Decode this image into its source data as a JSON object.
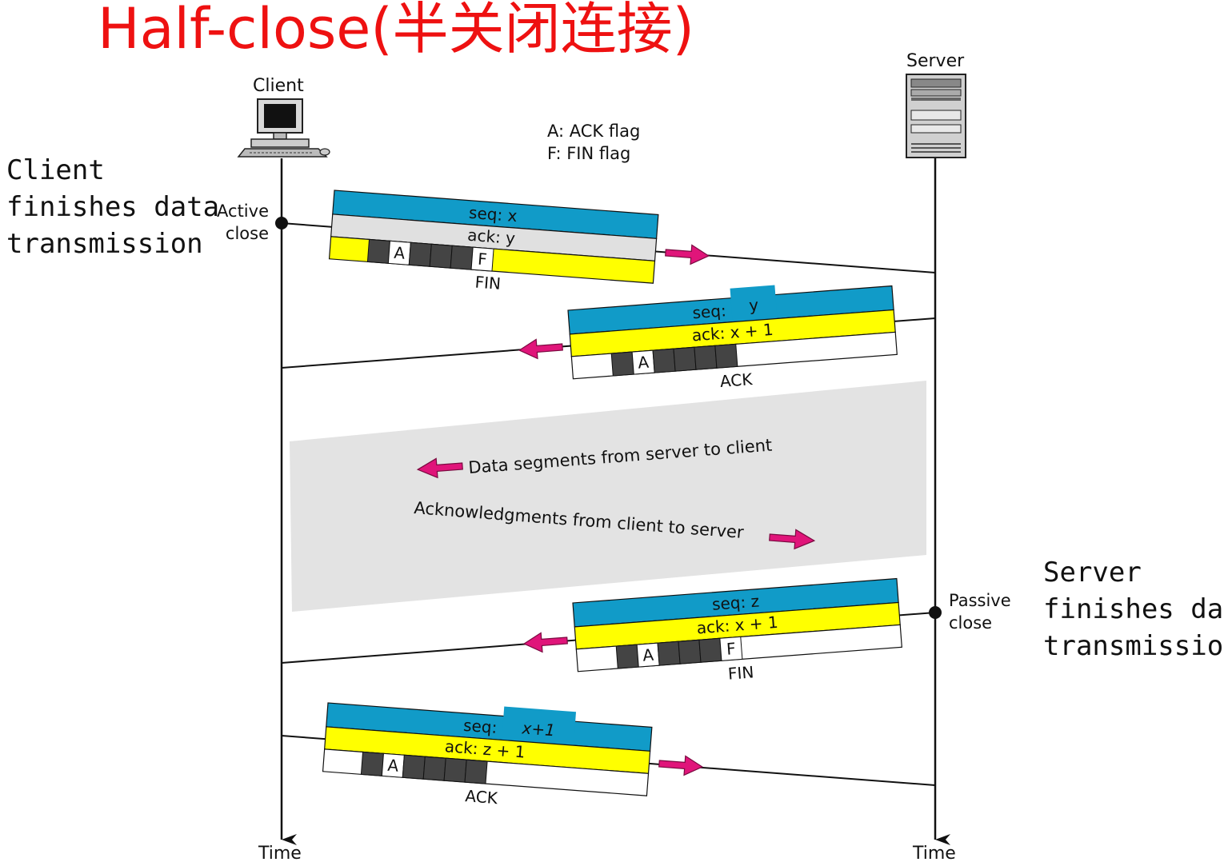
{
  "title": "Half-close(半关闭连接)",
  "client": {
    "label": "Client"
  },
  "server": {
    "label": "Server"
  },
  "legend": {
    "ack": "A: ACK flag",
    "fin": "F: FIN flag"
  },
  "notes": {
    "client_finishes": [
      "Client",
      "finishes data",
      "transmission"
    ],
    "server_finishes": [
      "Server",
      "finishes data",
      "transmission"
    ]
  },
  "active_close": [
    "Active",
    "close"
  ],
  "passive_close": [
    "Passive",
    "close"
  ],
  "time_label": "Time",
  "segments": {
    "fin1": {
      "seq": "seq: x",
      "ack": "ack: y",
      "flag_a": "A",
      "flag_f": "F",
      "caption": "FIN"
    },
    "ack1": {
      "seq": "seq:",
      "seq_value": "y",
      "ack": "ack: x + 1",
      "flag_a": "A",
      "caption": "ACK"
    },
    "fin2": {
      "seq": "seq: z",
      "ack": "ack: x + 1",
      "flag_a": "A",
      "flag_f": "F",
      "caption": "FIN"
    },
    "ack2": {
      "seq": "seq:",
      "seq_value": "x+1",
      "ack": "ack: z + 1",
      "flag_a": "A",
      "caption": "ACK"
    }
  },
  "data_phase": {
    "server_to_client": "Data segments from server to client",
    "client_to_server": "Acknowledgments from client to server"
  },
  "colors": {
    "title": "#ee1111",
    "seq_band": "#119bc8",
    "ack_yellow": "#ffff00",
    "ack_gray": "#e0e0e0",
    "flag_dark": "#444444",
    "arrow": "#e0157a",
    "data_region": "#e3e3e3"
  }
}
